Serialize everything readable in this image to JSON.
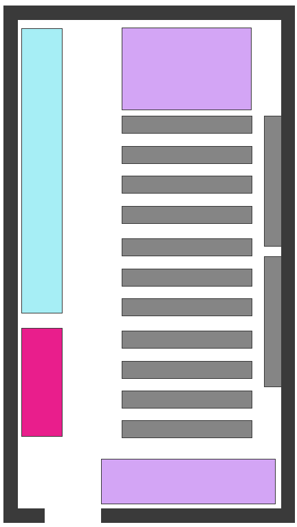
{
  "colors": {
    "wall": "#3a3a3a",
    "shelf": "#858585",
    "cyan_block": "#a6eef5",
    "magenta_block": "#e91e8c",
    "lavender_block": "#d3a5f5",
    "floor": "#ffffff"
  },
  "floorplan": {
    "center_shelf_count": 11,
    "side_shelf_count": 2,
    "entrance": "bottom-left gap"
  }
}
